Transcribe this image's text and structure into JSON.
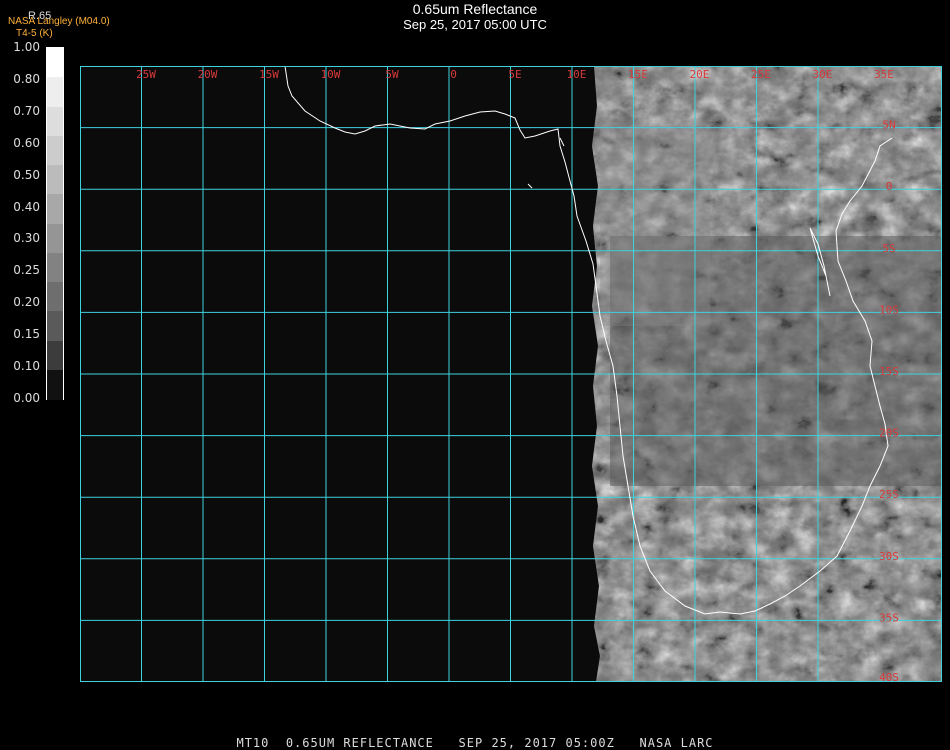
{
  "header": {
    "title": "0.65um Reflectance",
    "subtitle": "Sep 25, 2017 05:00 UTC",
    "credit_line1": "NASA Langley (M04.0)",
    "credit_line2": "T4-5 (K)"
  },
  "legend": {
    "title": "R.65",
    "labels": [
      "1.00",
      "0.80",
      "0.70",
      "0.60",
      "0.50",
      "0.40",
      "0.30",
      "0.25",
      "0.20",
      "0.15",
      "0.10",
      "0.00"
    ],
    "colors": [
      "#ffffff",
      "#eeeeee",
      "#dddddd",
      "#cccccc",
      "#bbbbbb",
      "#a8a8a8",
      "#959595",
      "#828282",
      "#6e6e6e",
      "#5a5a5a",
      "#3c3c3c",
      "#111111"
    ]
  },
  "map": {
    "lon_labels": [
      "25W",
      "20W",
      "15W",
      "10W",
      "5W",
      "0",
      "5E",
      "10E",
      "15E",
      "20E",
      "25E",
      "30E",
      "35E"
    ],
    "lat_labels": [
      "5N",
      "0",
      "5S",
      "10S",
      "15S",
      "20S",
      "25S",
      "30S",
      "35S",
      "40S"
    ],
    "grid_color": "#3fd2dc",
    "label_color": "#d83a3a",
    "coast_color": "#ffffff"
  },
  "footer": {
    "text": "MT10  0.65UM REFLECTANCE   SEP 25, 2017 05:00Z   NASA LARC"
  }
}
